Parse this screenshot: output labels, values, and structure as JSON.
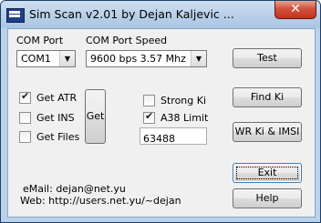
{
  "window": {
    "title": "Sim Scan v2.01 by Dejan Kaljevic ...",
    "close_glyph": "✕"
  },
  "com_port": {
    "label": "COM Port",
    "value": "COM1"
  },
  "com_speed": {
    "label": "COM Port Speed",
    "value": "9600 bps  3.57 Mhz"
  },
  "checks_left": [
    {
      "label": "Get ATR",
      "checked": true
    },
    {
      "label": "Get INS",
      "checked": false
    },
    {
      "label": "Get Files",
      "checked": false
    }
  ],
  "checks_right": [
    {
      "label": "Strong Ki",
      "checked": false
    },
    {
      "label": "A38 Limit",
      "checked": true
    }
  ],
  "limit_value": "63488",
  "buttons": {
    "test": "Test",
    "get": "Get",
    "find_ki": "Find Ki",
    "wr_ki": "WR Ki & IMSI",
    "exit": "Exit",
    "help": "Help"
  },
  "info": {
    "email": "eMail:  dejan@net.yu",
    "web": "Web: http://users.net.yu/~dejan"
  }
}
